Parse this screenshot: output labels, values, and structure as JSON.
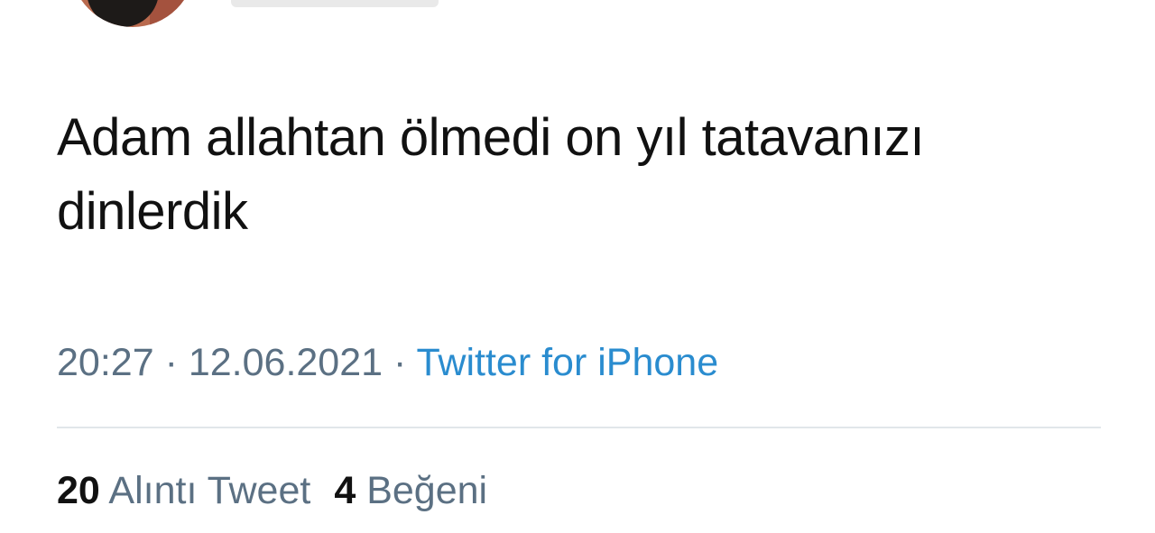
{
  "tweet": {
    "text_line1": "Adam allahtan ölmedi on yıl tatavanızı",
    "text_line2": "dinlerdik",
    "time": "20:27",
    "separator": "·",
    "date": "12.06.2021",
    "source": "Twitter for iPhone"
  },
  "stats": {
    "quote_count": "20",
    "quote_label": "Alıntı Tweet",
    "like_count": "4",
    "like_label": "Beğeni"
  },
  "colors": {
    "text": "#111111",
    "meta": "#5b7083",
    "link": "#2a8ccf",
    "divider": "#e1e6ea"
  }
}
